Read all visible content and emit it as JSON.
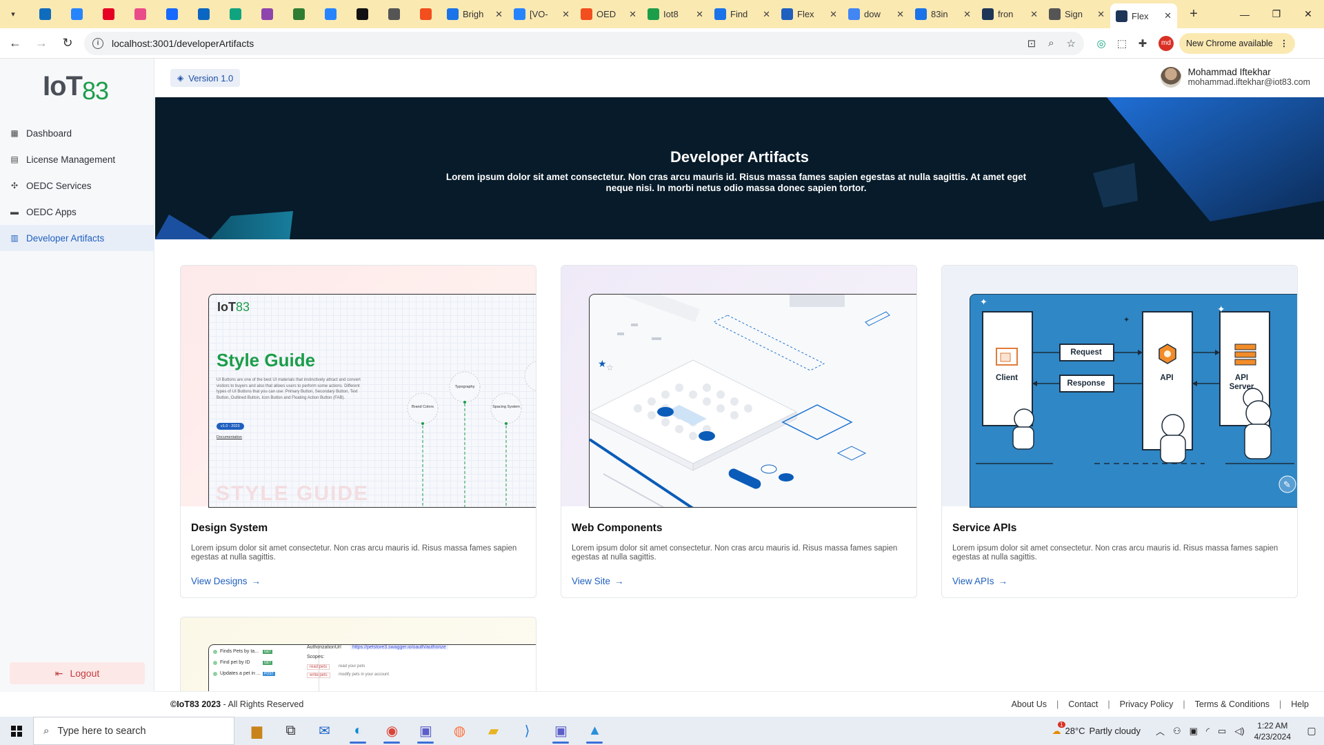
{
  "browser": {
    "pinned_tabs": [
      {
        "icon": "outlook-icon",
        "color": "#0f6cbd"
      },
      {
        "icon": "jira-icon",
        "color": "#2684ff"
      },
      {
        "icon": "pinterest-icon",
        "color": "#e60023"
      },
      {
        "icon": "dribbble-icon",
        "color": "#ea4c89"
      },
      {
        "icon": "behance-icon",
        "color": "#1769ff"
      },
      {
        "icon": "tool-icon",
        "color": "#0a66c2"
      },
      {
        "icon": "openai-icon",
        "color": "#10a37f"
      },
      {
        "icon": "user-group-icon",
        "color": "#8e44ad"
      },
      {
        "icon": "cloud-icon",
        "color": "#2e7d32"
      },
      {
        "icon": "jira-icon",
        "color": "#2684ff"
      },
      {
        "icon": "github-icon",
        "color": "#111111"
      },
      {
        "icon": "slider-icon",
        "color": "#555555"
      },
      {
        "icon": "figma-icon",
        "color": "#f24e1e"
      }
    ],
    "tabs": [
      {
        "title": "Brigh",
        "icon": "docs-icon",
        "color": "#1a73e8"
      },
      {
        "title": "[VO-",
        "icon": "jira-icon",
        "color": "#2684ff"
      },
      {
        "title": "OED",
        "icon": "figma-icon",
        "color": "#f24e1e"
      },
      {
        "title": "Iot8",
        "icon": "iot-icon",
        "color": "#1c9d4a"
      },
      {
        "title": "Find",
        "icon": "flag-icon",
        "color": "#1a73e8"
      },
      {
        "title": "Flex",
        "icon": "flex-icon",
        "color": "#1f5fbf"
      },
      {
        "title": "dow",
        "icon": "google-icon",
        "color": "#4285f4"
      },
      {
        "title": "83in",
        "icon": "shield-icon",
        "color": "#1a73e8"
      },
      {
        "title": "fron",
        "icon": "medium-icon",
        "color": "#1d3557"
      },
      {
        "title": "Sign",
        "icon": "globe-icon",
        "color": "#555555"
      },
      {
        "title": "Flex",
        "icon": "medium-icon",
        "color": "#1d3557",
        "active": true
      }
    ],
    "url": "localhost:3001/developerArtifacts",
    "new_chrome": "New Chrome available",
    "profile_initials": "md"
  },
  "sidebar": {
    "logo_text": "IoT",
    "logo_num": "83",
    "items": [
      {
        "label": "Dashboard",
        "icon": "dashboard-icon"
      },
      {
        "label": "License Management",
        "icon": "license-icon"
      },
      {
        "label": "OEDC Services",
        "icon": "services-icon"
      },
      {
        "label": "OEDC Apps",
        "icon": "apps-icon"
      },
      {
        "label": "Developer Artifacts",
        "icon": "artifacts-icon",
        "active": true
      }
    ],
    "logout": "Logout"
  },
  "header": {
    "version": "Version 1.0",
    "user_name": "Mohammad Iftekhar",
    "user_email": "mohammad.iftekhar@iot83.com"
  },
  "hero": {
    "title": "Developer Artifacts",
    "text": "Lorem ipsum dolor sit amet consectetur. Non cras arcu mauris id. Risus massa fames sapien egestas at nulla sagittis. At amet eget neque nisi. In morbi netus odio massa donec sapien tortor."
  },
  "cards": [
    {
      "title": "Design System",
      "desc": "Lorem ipsum dolor sit amet consectetur. Non cras arcu mauris id. Risus massa fames sapien egestas at nulla sagittis.",
      "link": "View Designs"
    },
    {
      "title": "Web Components",
      "desc": "Lorem ipsum dolor sit amet consectetur. Non cras arcu mauris id. Risus massa fames sapien egestas at nulla sagittis.",
      "link": "View Site"
    },
    {
      "title": "Service APIs",
      "desc": "Lorem ipsum dolor sit amet consectetur. Non cras arcu mauris id. Risus massa fames sapien egestas at nulla sagittis.",
      "link": "View APIs"
    }
  ],
  "thumbs": {
    "style_guide": {
      "logo": "IoT",
      "logo_num": "83",
      "title": "Style Guide",
      "body": "UI Buttons are one of the best UI materials that instinctively attract and convert visitors to buyers and also that allows users to perform some actions. Different types of UI Buttons that you can use: Primary Button, Secondary Button, Text Button, Outlined Button, Icon Button and Floating Action Button (FAB).",
      "badge": "v1.0 - 2023",
      "doc_link": "Documentation",
      "watermark": "STYLE GUIDE",
      "nodes": [
        "Brand Colors",
        "Typography",
        "Spacing System"
      ]
    },
    "service_apis": {
      "client": "Client",
      "request": "Request",
      "response": "Response",
      "api": "API",
      "api_server": "API Server"
    },
    "swagger": {
      "rows": [
        {
          "label": "Finds Pets by ta...",
          "method": "GET"
        },
        {
          "label": "Find pet by ID",
          "method": "GET"
        },
        {
          "label": "Updates a pet in ...",
          "method": "POST"
        }
      ],
      "auth_label": "AuthorizationUrl",
      "auth_url": "https://petstore3.swagger.io/oauth/authorize",
      "scopes_label": "Scopes:",
      "scopes": [
        {
          "name": "read:pets",
          "desc": "read your pets"
        },
        {
          "name": "write:pets",
          "desc": "modify pets in your account"
        }
      ]
    }
  },
  "footer": {
    "copyright_bold": "©IoT83 2023",
    "copyright_rest": " - All Rights Reserved",
    "links": [
      "About Us",
      "Contact",
      "Privacy Policy",
      "Terms & Conditions",
      "Help"
    ]
  },
  "taskbar": {
    "search_placeholder": "Type here to search",
    "apps": [
      "briefcase-icon",
      "task-view-icon",
      "mail-icon",
      "edge-icon",
      "chrome-icon",
      "teams-icon",
      "firefox-icon",
      "file-explorer-icon",
      "vscode-icon",
      "teams-icon",
      "photos-icon"
    ],
    "weather_temp": "28°C",
    "weather_text": "Partly cloudy",
    "weather_badge": "1",
    "time": "1:22 AM",
    "date": "4/23/2024"
  }
}
